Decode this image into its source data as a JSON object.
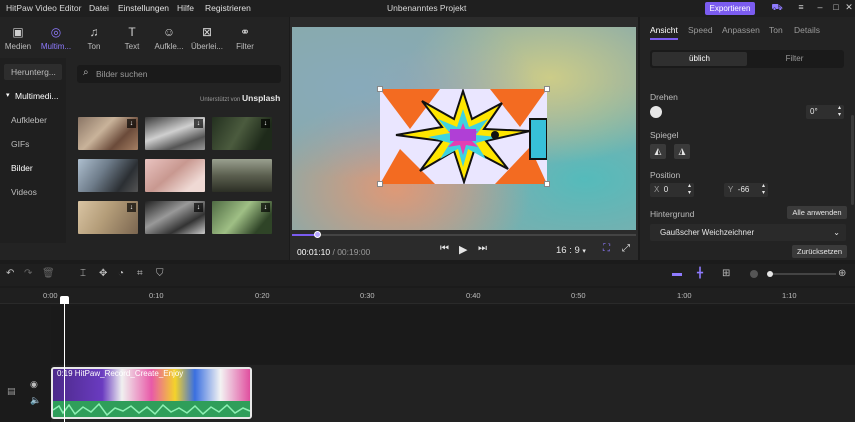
{
  "titlebar": {
    "app": "HitPaw Video Editor",
    "menu": [
      "Datei",
      "Einstellungen",
      "Hilfe",
      "Registrieren"
    ],
    "project": "Unbenanntes Projekt",
    "export": "Exportieren"
  },
  "toptabs": [
    {
      "label": "Medien",
      "icon": "media-icon"
    },
    {
      "label": "Multim...",
      "icon": "multimedia-icon"
    },
    {
      "label": "Ton",
      "icon": "music-icon"
    },
    {
      "label": "Text",
      "icon": "text-icon"
    },
    {
      "label": "Aufkle...",
      "icon": "sticker-icon"
    },
    {
      "label": "Überlei...",
      "icon": "transition-icon"
    },
    {
      "label": "Filter",
      "icon": "filter-icon"
    }
  ],
  "sidebar": [
    "Herunterg...",
    "Multimedi...",
    "Aufkleber",
    "GIFs",
    "Bilder",
    "Videos"
  ],
  "search": {
    "placeholder": "Bilder suchen"
  },
  "unsplash": {
    "prefix": "Unterstützt von",
    "brand": "Unsplash"
  },
  "preview": {
    "current": "00:01:10",
    "sep": " / ",
    "total": "00:19:00",
    "ratio": "16 : 9",
    "progress": 0.075
  },
  "right": {
    "tabs": [
      "Ansicht",
      "Speed",
      "Anpassen",
      "Ton",
      "Details"
    ],
    "seg_on": "üblich",
    "seg_off": "Filter",
    "rotate_label": "Drehen",
    "rotate_value": "0°",
    "mirror_label": "Spiegel",
    "position_label": "Position",
    "pos_x_label": "X",
    "pos_x": "0",
    "pos_y_label": "Y",
    "pos_y": "-66",
    "bg_label": "Hintergrund",
    "apply_all": "Alle anwenden",
    "bg_value": "Gaußscher Weichzeichner",
    "reset": "Zurücksetzen"
  },
  "ruler": [
    "0:00",
    "0:10",
    "0:20",
    "0:30",
    "0:40",
    "0:50",
    "1:00",
    "1:10"
  ],
  "clip": {
    "label": "0:19    HitPaw_Record_Create_Enjoy"
  },
  "colors": {
    "accent": "#7b5cf0",
    "bg": "#1b1b1b"
  }
}
